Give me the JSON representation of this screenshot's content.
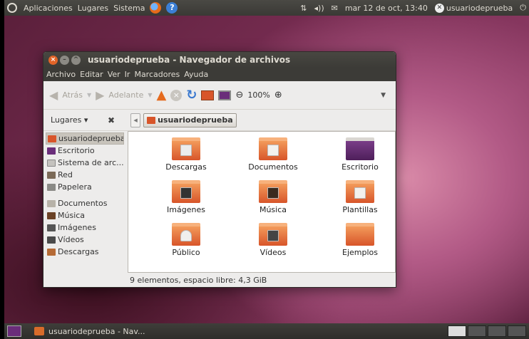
{
  "top_panel": {
    "menu_apps": "Aplicaciones",
    "menu_places": "Lugares",
    "menu_system": "Sistema",
    "network_icon": "⇅",
    "volume_icon": "◂))",
    "mail_icon": "✉",
    "clock": "mar 12 de oct, 13:40",
    "user": "usuariodeprueba",
    "power_icon": "⏻"
  },
  "window": {
    "title": "usuariodeprueba - Navegador de archivos",
    "menus": [
      "Archivo",
      "Editar",
      "Ver",
      "Ir",
      "Marcadores",
      "Ayuda"
    ],
    "toolbar": {
      "back": "Atrás",
      "forward": "Adelante",
      "zoom": "100%"
    },
    "places_label": "Lugares ▾",
    "path": "usuariodeprueba",
    "sidebar": [
      "usuariodeprueba",
      "Escritorio",
      "Sistema de arc...",
      "Red",
      "Papelera",
      "Documentos",
      "Música",
      "Imágenes",
      "Vídeos",
      "Descargas"
    ],
    "files": [
      "Descargas",
      "Documentos",
      "Escritorio",
      "Imágenes",
      "Música",
      "Plantillas",
      "Público",
      "Vídeos",
      "Ejemplos"
    ],
    "status": "9 elementos, espacio libre: 4,3 GiB"
  },
  "bottom_panel": {
    "task": "usuariodeprueba - Nav..."
  }
}
